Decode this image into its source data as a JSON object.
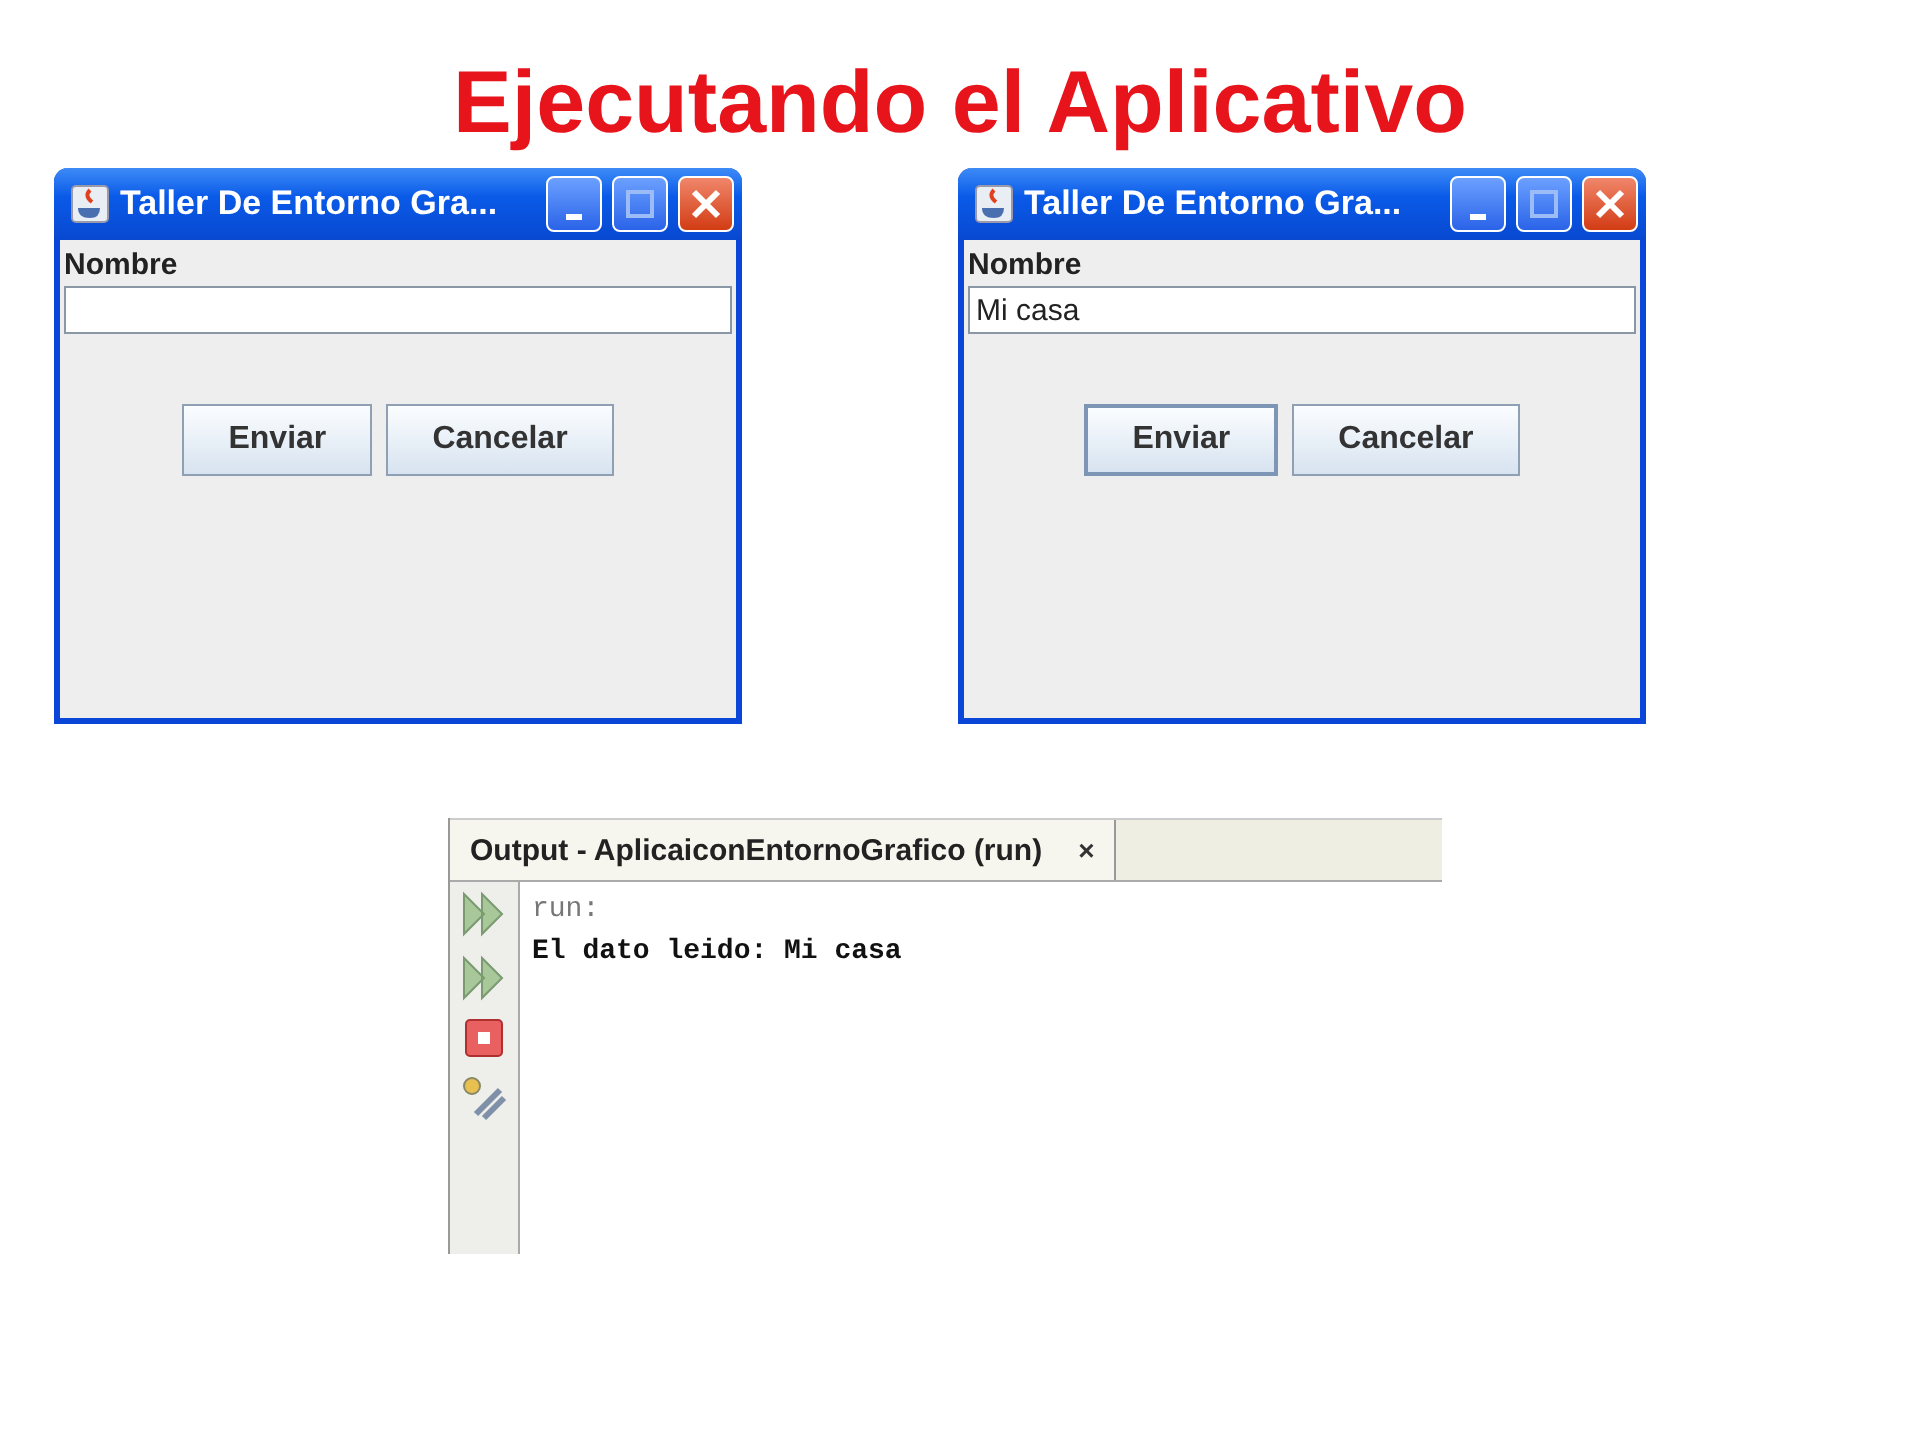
{
  "title": "Ejecutando el Aplicativo",
  "windows": [
    {
      "title": "Taller De Entorno Gra...",
      "label": "Nombre",
      "buttons": [
        {
          "label": "Enviar",
          "focused": false
        },
        {
          "label": "Cancelar",
          "focused": false
        }
      ]
    },
    {
      "title": "Taller De Entorno Gra...",
      "label": "Nombre",
      "value": "Mi casa",
      "buttons": [
        {
          "label": "Enviar",
          "focused": true
        },
        {
          "label": "Cancelar",
          "focused": false
        }
      ]
    }
  ],
  "output": {
    "tab": "Output - AplicaiconEntornoGrafico (run)",
    "close": "×",
    "lines": [
      {
        "kind": "command",
        "text": "run:"
      },
      {
        "kind": "output",
        "text": "El dato leido: Mi casa"
      }
    ]
  }
}
